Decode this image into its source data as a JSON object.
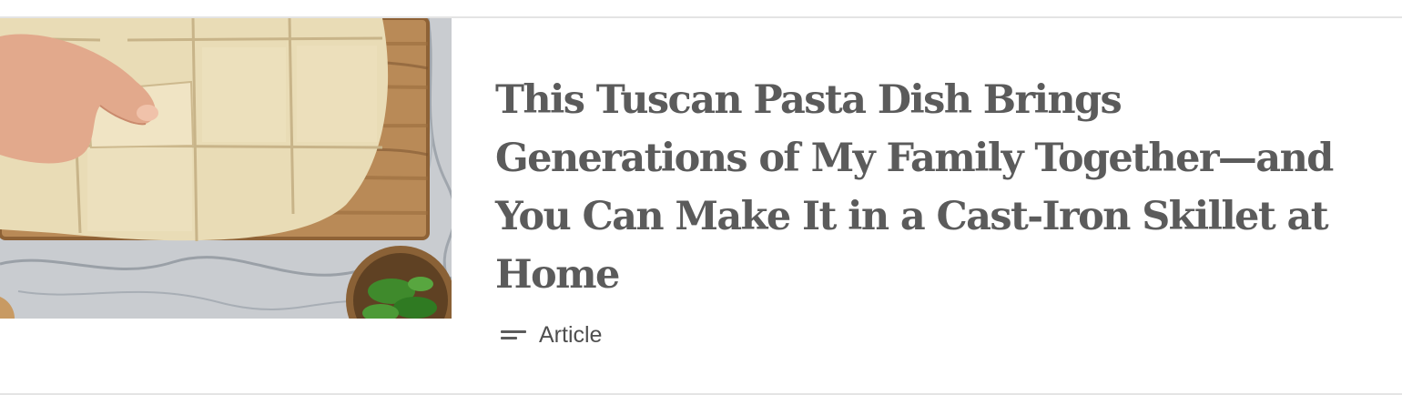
{
  "card": {
    "title": "This Tuscan Pasta Dish Brings Generations of My Family Together—and You Can Make It in a Cast-Iron Skillet at Home",
    "content_type": {
      "icon": "article-icon",
      "label": "Article"
    },
    "thumbnail": {
      "alt": "Hands cutting squares of fresh pasta dough on a wooden board over marble"
    }
  },
  "colors": {
    "title": "#5b5b5b",
    "meta": "#4f4f4f",
    "divider": "#e4e4e4"
  }
}
